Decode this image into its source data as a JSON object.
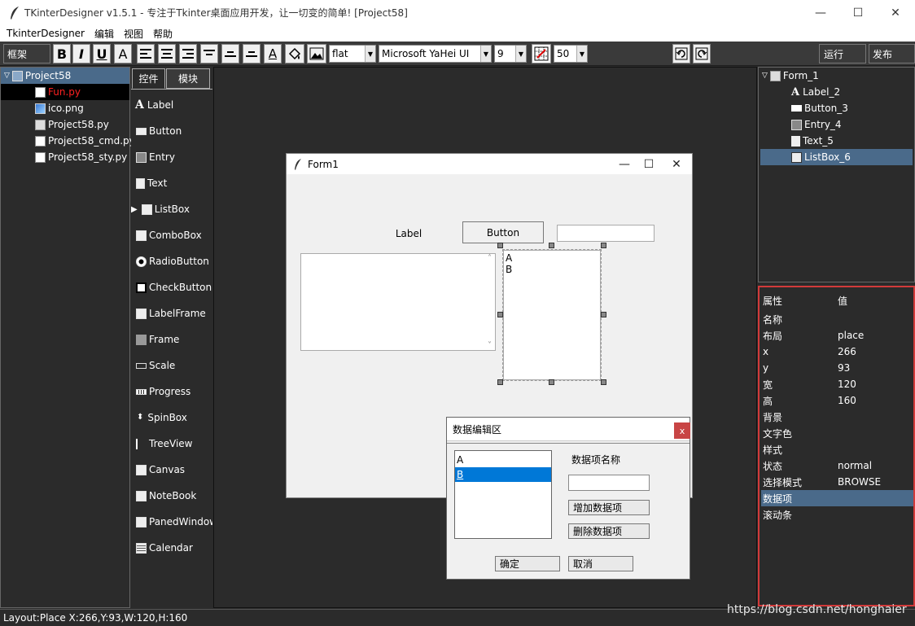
{
  "window": {
    "title": "TKinterDesigner v1.5.1 - 专注于Tkinter桌面应用开发，让一切变的简单!    [Project58]",
    "controls": [
      "—",
      "☐",
      "✕"
    ]
  },
  "menu": [
    "TkinterDesigner",
    "编辑",
    "视图",
    "帮助"
  ],
  "toolbar": {
    "frame_label": "框架",
    "bold": "B",
    "italic": "I",
    "underline": "U",
    "font_a": "A",
    "font_color_a": "A",
    "relief": "flat",
    "font": "Microsoft YaHei UI",
    "size": "9",
    "grid": "50",
    "run": "运行",
    "publish": "发布"
  },
  "project": {
    "root": "Project58",
    "files": [
      {
        "name": "Fun.py",
        "active": true
      },
      {
        "name": "ico.png",
        "active": false
      },
      {
        "name": "Project58.py",
        "active": false
      },
      {
        "name": "Project58_cmd.py",
        "active": false
      },
      {
        "name": "Project58_sty.py",
        "active": false
      }
    ]
  },
  "palette": {
    "tabs": [
      "控件",
      "模块"
    ],
    "items": [
      "Label",
      "Button",
      "Entry",
      "Text",
      "ListBox",
      "ComboBox",
      "RadioButton",
      "CheckButton",
      "LabelFrame",
      "Frame",
      "Scale",
      "Progress",
      "SpinBox",
      "TreeView",
      "Canvas",
      "NoteBook",
      "PanedWindow",
      "Calendar"
    ]
  },
  "form": {
    "title": "Form1",
    "label": "Label",
    "button": "Button",
    "entry_value": "",
    "listbox_items": [
      "A",
      "B"
    ],
    "scroll_up": "˄",
    "scroll_down": "˅"
  },
  "dialog": {
    "title": "数据编辑区",
    "close": "x",
    "items": [
      "A",
      "B"
    ],
    "selected_index": 1,
    "field_label": "数据项名称",
    "field_value": "",
    "add_button": "增加数据项",
    "delete_button": "删除数据项",
    "ok_button": "确定",
    "cancel_button": "取消"
  },
  "widget_tree": {
    "root": "Form_1",
    "children": [
      {
        "name": "Label_2",
        "selected": false
      },
      {
        "name": "Button_3",
        "selected": false
      },
      {
        "name": "Entry_4",
        "selected": false
      },
      {
        "name": "Text_5",
        "selected": false
      },
      {
        "name": "ListBox_6",
        "selected": true
      }
    ]
  },
  "properties": {
    "header_key": "属性",
    "header_value": "值",
    "rows": [
      {
        "key": "名称",
        "value": ""
      },
      {
        "key": "布局",
        "value": "place"
      },
      {
        "key": "x",
        "value": "266"
      },
      {
        "key": "y",
        "value": "93"
      },
      {
        "key": "宽",
        "value": "120"
      },
      {
        "key": "高",
        "value": "160"
      },
      {
        "key": "背景",
        "value": ""
      },
      {
        "key": "文字色",
        "value": ""
      },
      {
        "key": "样式",
        "value": ""
      },
      {
        "key": "状态",
        "value": "normal"
      },
      {
        "key": "选择模式",
        "value": "BROWSE"
      },
      {
        "key": "数据项",
        "value": "",
        "selected": true
      },
      {
        "key": "滚动条",
        "value": ""
      }
    ]
  },
  "status": "Layout:Place  X:266,Y:93,W:120,H:160",
  "watermark": "https://blog.csdn.net/honghaier",
  "colors": {
    "accent_selected": "#4a6a8a",
    "dialog_selected": "#0078d7",
    "highlight_border": "#d23a3a",
    "active_file": "#ff2020"
  }
}
